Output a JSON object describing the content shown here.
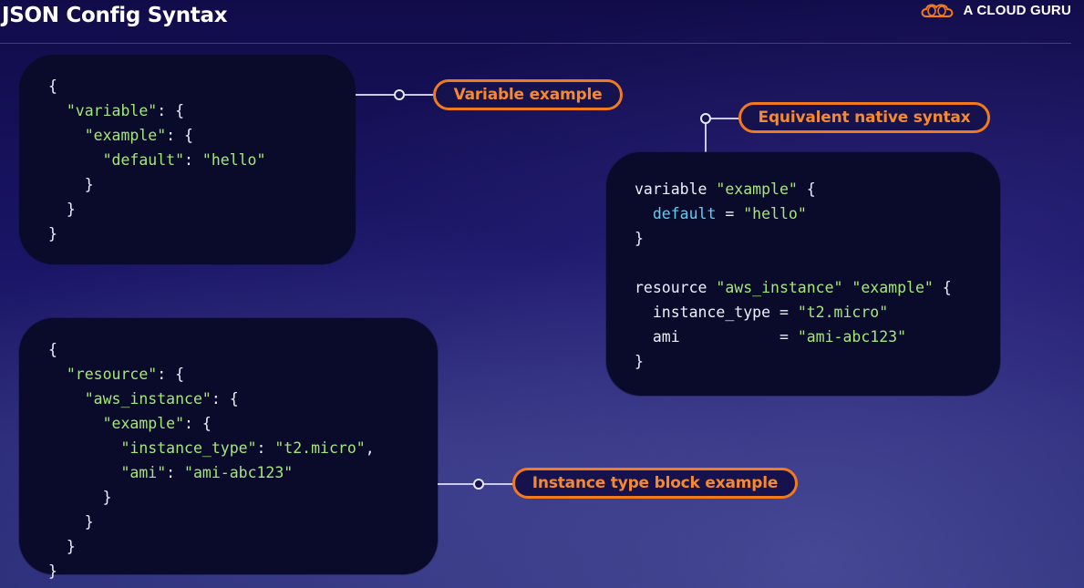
{
  "header": {
    "title": "JSON Config Syntax",
    "brand": "A CLOUD GURU"
  },
  "callouts": {
    "variable": "Variable example",
    "native": "Equivalent native syntax",
    "instance": "Instance type block example"
  },
  "code": {
    "json_variable": [
      "{",
      "  \"variable\": {",
      "    \"example\": {",
      "      \"default\": \"hello\"",
      "    }",
      "  }",
      "}"
    ],
    "native": [
      "variable \"example\" {",
      "  default = \"hello\"",
      "}",
      "",
      "resource \"aws_instance\" \"example\" {",
      "  instance_type = \"t2.micro\"",
      "  ami           = \"ami-abc123\"",
      "}"
    ],
    "json_resource": [
      "{",
      "  \"resource\": {",
      "    \"aws_instance\": {",
      "      \"example\": {",
      "        \"instance_type\": \"t2.micro\",",
      "        \"ami\": \"ami-abc123\"",
      "      }",
      "    }",
      "  }",
      "}"
    ]
  },
  "colors": {
    "accent": "#f17a1f",
    "string": "#a6e57c",
    "keyword": "#5fd0ef",
    "code_bg": "#0a0a2b"
  }
}
